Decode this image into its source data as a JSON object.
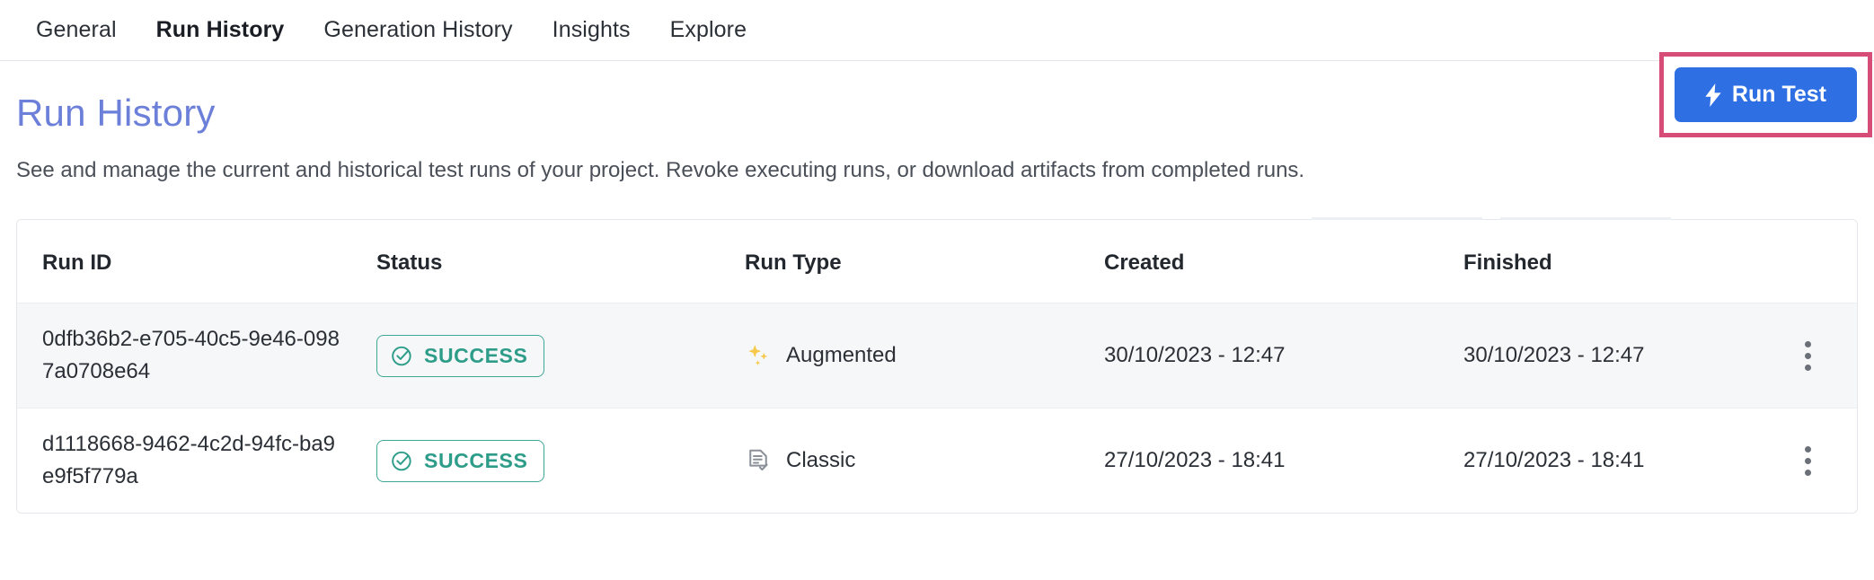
{
  "tabs": [
    {
      "label": "General",
      "active": false
    },
    {
      "label": "Run History",
      "active": true
    },
    {
      "label": "Generation History",
      "active": false
    },
    {
      "label": "Insights",
      "active": false
    },
    {
      "label": "Explore",
      "active": false
    }
  ],
  "page": {
    "title": "Run History",
    "description": "See and manage the current and historical test runs of your project. Revoke executing runs, or download artifacts from completed runs."
  },
  "actions": {
    "run_test_label": "Run Test",
    "run_test_icon": "lightning-bolt-icon",
    "highlight_color": "#d64d77",
    "button_color": "#2f6fe4"
  },
  "table": {
    "columns": [
      "Run ID",
      "Status",
      "Run Type",
      "Created",
      "Finished"
    ],
    "rows": [
      {
        "run_id": "0dfb36b2-e705-40c5-9e46-0987a0708e64",
        "status": "SUCCESS",
        "status_icon": "check-circle-icon",
        "run_type": "Augmented",
        "run_type_icon": "sparkles-icon",
        "created": "30/10/2023 - 12:47",
        "finished": "30/10/2023 - 12:47",
        "menu_icon": "kebab-menu-icon"
      },
      {
        "run_id": "d1118668-9462-4c2d-94fc-ba9e9f5f779a",
        "status": "SUCCESS",
        "status_icon": "check-circle-icon",
        "run_type": "Classic",
        "run_type_icon": "document-check-icon",
        "created": "27/10/2023 - 18:41",
        "finished": "27/10/2023 - 18:41",
        "menu_icon": "kebab-menu-icon"
      }
    ]
  },
  "colors": {
    "accent_blue": "#2f6fe4",
    "title_blue": "#6c80d9",
    "success_teal": "#2d9c89",
    "sparkle_yellow": "#f5c council",
    "highlight_pink": "#d64d77"
  }
}
